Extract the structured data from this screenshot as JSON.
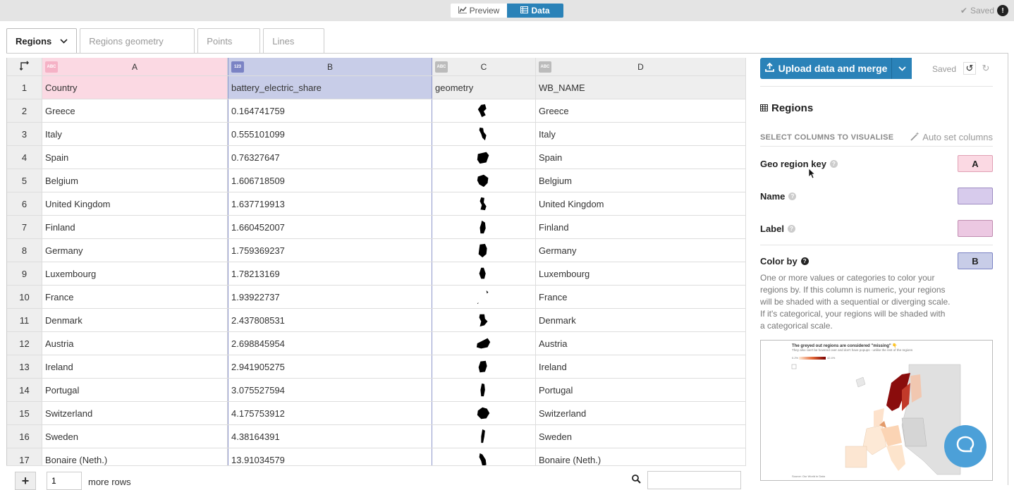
{
  "topbar": {
    "preview_label": "Preview",
    "data_label": "Data",
    "saved_label": "Saved",
    "warning_icon": "warning-icon"
  },
  "tabs": [
    {
      "label": "Regions",
      "active": true
    },
    {
      "label": "Regions geometry",
      "active": false
    },
    {
      "label": "Points",
      "active": false
    },
    {
      "label": "Lines",
      "active": false
    }
  ],
  "grid": {
    "columns": [
      {
        "letter": "A",
        "type": "ABC"
      },
      {
        "letter": "B",
        "type": "123"
      },
      {
        "letter": "C",
        "type": "ABC"
      },
      {
        "letter": "D",
        "type": "ABC"
      }
    ],
    "header_row": {
      "num": "1",
      "a": "Country",
      "b": "battery_electric_share",
      "c": "geometry",
      "d": "WB_NAME"
    },
    "rows": [
      {
        "num": "2",
        "a": "Greece",
        "b": "0.164741759",
        "d": "Greece"
      },
      {
        "num": "3",
        "a": "Italy",
        "b": "0.555101099",
        "d": "Italy"
      },
      {
        "num": "4",
        "a": "Spain",
        "b": "0.76327647",
        "d": "Spain"
      },
      {
        "num": "5",
        "a": "Belgium",
        "b": "1.606718509",
        "d": "Belgium"
      },
      {
        "num": "6",
        "a": "United Kingdom",
        "b": "1.637719913",
        "d": "United Kingdom"
      },
      {
        "num": "7",
        "a": "Finland",
        "b": "1.660452007",
        "d": "Finland"
      },
      {
        "num": "8",
        "a": "Germany",
        "b": "1.759369237",
        "d": "Germany"
      },
      {
        "num": "9",
        "a": "Luxembourg",
        "b": "1.78213169",
        "d": "Luxembourg"
      },
      {
        "num": "10",
        "a": "France",
        "b": "1.93922737",
        "d": "France"
      },
      {
        "num": "11",
        "a": "Denmark",
        "b": "2.437808531",
        "d": "Denmark"
      },
      {
        "num": "12",
        "a": "Austria",
        "b": "2.698845954",
        "d": "Austria"
      },
      {
        "num": "13",
        "a": "Ireland",
        "b": "2.941905275",
        "d": "Ireland"
      },
      {
        "num": "14",
        "a": "Portugal",
        "b": "3.075527594",
        "d": "Portugal"
      },
      {
        "num": "15",
        "a": "Switzerland",
        "b": "4.175753912",
        "d": "Switzerland"
      },
      {
        "num": "16",
        "a": "Sweden",
        "b": "4.38164391",
        "d": "Sweden"
      },
      {
        "num": "17",
        "a": "Bonaire (Neth.)",
        "b": "13.91034579",
        "d": "Bonaire (Neth.)"
      }
    ]
  },
  "bottombar": {
    "add_label": "+",
    "rows_value": "1",
    "more_rows_label": "more rows"
  },
  "panel": {
    "upload_label": "Upload data and merge",
    "saved_label": "Saved",
    "section_title": "Regions",
    "select_columns_label": "SELECT COLUMNS TO VISUALISE",
    "auto_set_label": "Auto set columns",
    "fields": [
      {
        "label": "Geo region key",
        "value": "A",
        "color": "#fbd9e3"
      },
      {
        "label": "Name",
        "value": "",
        "color": "#d7cbec"
      },
      {
        "label": "Label",
        "value": "",
        "color": "#ecc8e2"
      },
      {
        "label": "Color by",
        "value": "B",
        "color": "#c8cde8"
      }
    ],
    "help_text": "One or more values or categories to color your regions by. If this column is numeric, your regions will be shaded with a sequential or diverging scale. If it's categorical, your regions will be shaded with a categorical scale.",
    "preview": {
      "title": "The greyed out regions are considered \"missing\" 👇",
      "subtitle": "They also can't be hovered over and don't have popups - unlike the rest of the regions",
      "legend_min": "0.2%",
      "legend_max": "42.4%",
      "source": "Source: Our World in Data"
    }
  },
  "colors": {
    "accent": "#2a82b8",
    "col_a": "#fbd9e3",
    "col_b": "#c8cde8",
    "chat": "#4ca0d8"
  }
}
